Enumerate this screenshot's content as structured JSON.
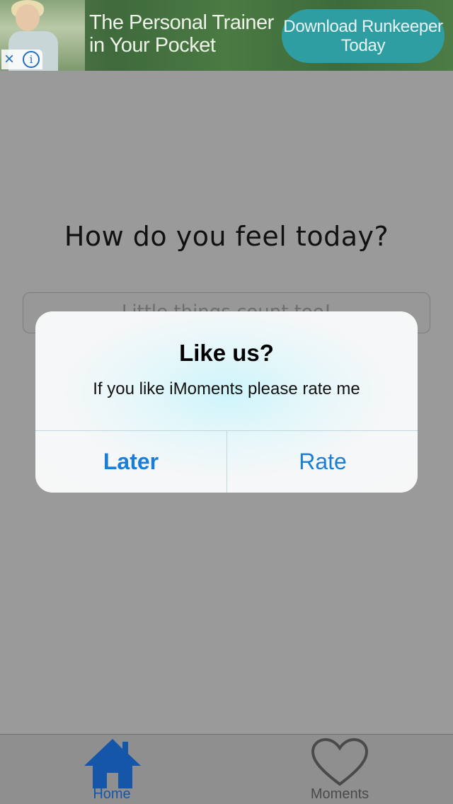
{
  "ad": {
    "headline": "The Personal Trainer in Your Pocket",
    "cta": "Download Runkeeper Today",
    "close_symbol": "×",
    "info_symbol": "i"
  },
  "main": {
    "question": "How do you feel today?",
    "input_placeholder": "Little things count too!"
  },
  "alert": {
    "title": "Like us?",
    "message": "If you like iMoments please rate me",
    "buttons": {
      "later": "Later",
      "rate": "Rate"
    }
  },
  "tabbar": {
    "tabs": [
      {
        "label": "Home",
        "icon": "home-icon",
        "selected": true
      },
      {
        "label": "Moments",
        "icon": "heart-icon",
        "selected": false
      }
    ]
  },
  "colors": {
    "accent": "#1a7ed6",
    "tab_selected": "#1556a8",
    "overlay": "#9a9a9a"
  }
}
